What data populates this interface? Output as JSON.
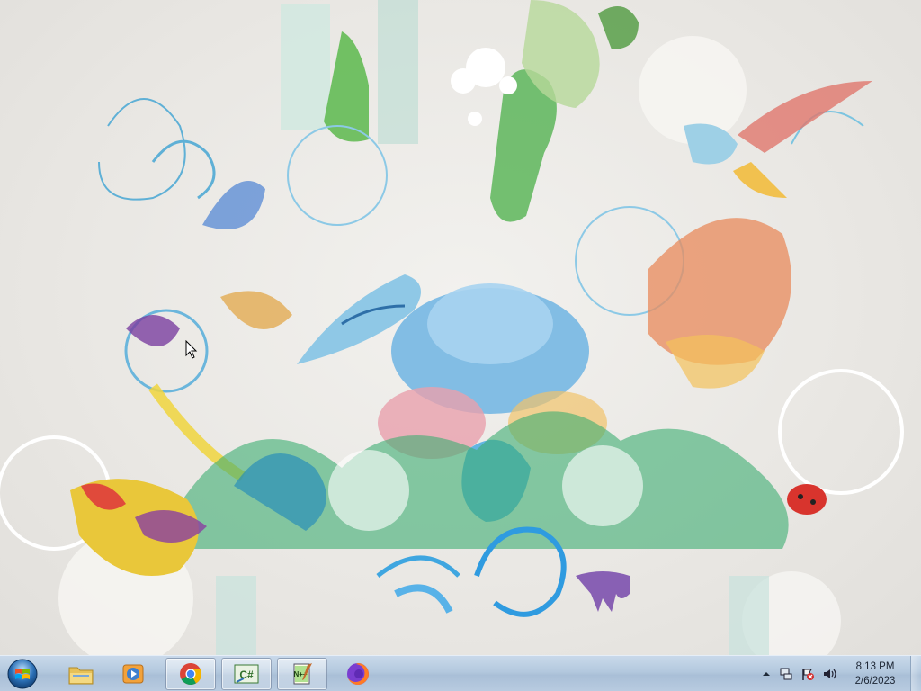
{
  "desktop": {
    "wallpaper": "watercolor floral with birds wallpaper"
  },
  "taskbar": {
    "start_icon": "windows-orb-icon",
    "items": [
      {
        "name": "File Explorer",
        "icon": "folder-icon",
        "open": false
      },
      {
        "name": "Windows Media Player",
        "icon": "media-player-icon",
        "open": false
      },
      {
        "name": "Google Chrome",
        "icon": "chrome-icon",
        "open": true
      },
      {
        "name": "C# Editor",
        "icon": "csharp-icon",
        "open": true
      },
      {
        "name": "Notepad++",
        "icon": "notepadpp-icon",
        "open": true
      },
      {
        "name": "Firefox",
        "icon": "firefox-icon",
        "open": false
      }
    ]
  },
  "tray": {
    "icons": [
      "show-hidden-icons-chevron",
      "network-icon",
      "action-center-flag-icon",
      "volume-icon"
    ],
    "clock": {
      "time": "8:13 PM",
      "date": "2/6/2023"
    }
  },
  "colors": {
    "taskbar": "#b3c8de",
    "accent_blue": "#3a8fd0"
  }
}
